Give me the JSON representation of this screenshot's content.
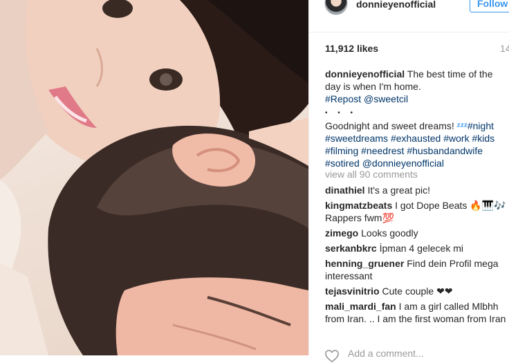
{
  "post": {
    "username": "donnieyenofficial",
    "follow_label": "Follow",
    "likes": "11,912 likes",
    "time": "14",
    "caption": {
      "user": "donnieyenofficial",
      "text1": "The best time of the day is when I'm home.",
      "repost": "#Repost",
      "mention": "@sweetcil",
      "dots": "• • •",
      "text2": "Goodnight and sweet dreams! ",
      "zzz": "ᶻᶻᶻ",
      "tags": [
        "#night",
        "#sweetdreams",
        "#exhausted",
        "#work",
        "#kids",
        "#filming",
        "#needrest",
        "#husbandandwife",
        "#sotired"
      ],
      "final_mention": "@donnieyenofficial"
    },
    "view_all": "view all 90 comments",
    "comments": [
      {
        "user": "dinathiel",
        "text": "It's a great pic!"
      },
      {
        "user": "kingmatzbeats",
        "text": "I got Dope Beats 🔥🎹🎶 Rappers fwm💯"
      },
      {
        "user": "zimego",
        "text": "Looks goodly"
      },
      {
        "user": "serkanbkrc",
        "text": "İpman 4 gelecek mi"
      },
      {
        "user": "henning_gruener",
        "text": "Find dein Profil mega interessant"
      },
      {
        "user": "tejasvinitrio",
        "text": "Cute couple ❤❤"
      },
      {
        "user": "mali_mardi_fan",
        "text": "I am a girl called Mlbhh from Iran. .. I am the first woman from Iran"
      }
    ],
    "add_comment_placeholder": "Add a comment..."
  }
}
